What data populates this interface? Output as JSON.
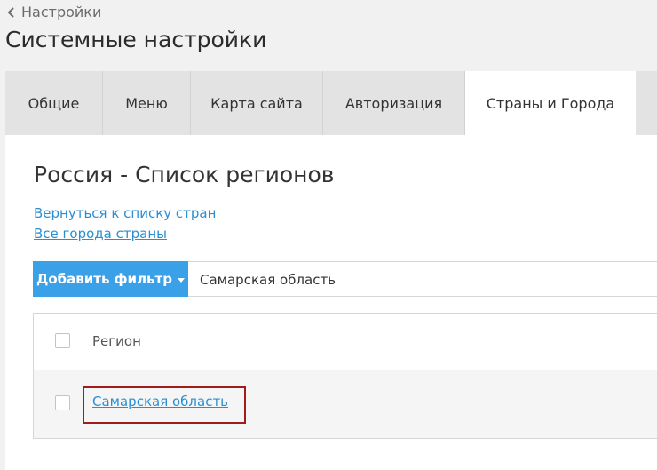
{
  "breadcrumb": {
    "back_label": "Настройки"
  },
  "page": {
    "title": "Системные настройки"
  },
  "tabs": [
    {
      "label": "Общие"
    },
    {
      "label": "Меню"
    },
    {
      "label": "Карта сайта"
    },
    {
      "label": "Авторизация"
    },
    {
      "label": "Страны и Города"
    }
  ],
  "active_tab": "Страны и Города",
  "section": {
    "title": "Россия - Список регионов",
    "links": [
      "Вернуться к списку стран",
      "Все города страны"
    ]
  },
  "filter": {
    "button_label": "Добавить фильтр",
    "value": "Самарская область"
  },
  "table": {
    "columns": [
      "Регион"
    ],
    "rows": [
      {
        "region": "Самарская область"
      }
    ]
  },
  "colors": {
    "accent": "#3aa0e8",
    "link": "#2a8fd1",
    "highlight": "#a01c1c"
  }
}
